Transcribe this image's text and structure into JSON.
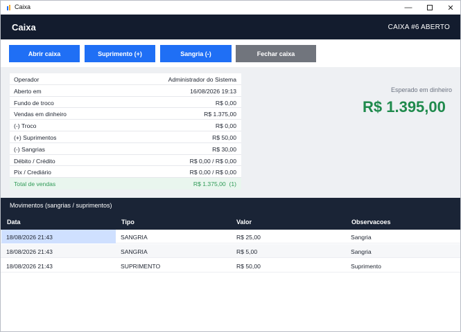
{
  "window": {
    "title": "Caixa"
  },
  "header": {
    "title": "Caixa",
    "status": "CAIXA #6 ABERTO"
  },
  "toolbar": {
    "buttons": [
      {
        "label": "Abrir caixa"
      },
      {
        "label": "Suprimento (+)"
      },
      {
        "label": "Sangria (-)"
      },
      {
        "label": "Fechar caixa"
      }
    ]
  },
  "summary": {
    "rows": [
      {
        "label": "Operador",
        "value": "Administrador do Sistema"
      },
      {
        "label": "Aberto em",
        "value": "16/08/2026 19:13"
      },
      {
        "label": "Fundo de troco",
        "value": "R$ 0,00"
      },
      {
        "label": "Vendas em dinheiro",
        "value": "R$ 1.375,00"
      },
      {
        "label": "(-) Troco",
        "value": "R$ 0,00"
      },
      {
        "label": "(+) Suprimentos",
        "value": "R$ 50,00"
      },
      {
        "label": "(-) Sangrias",
        "value": "R$ 30,00"
      },
      {
        "label": "Débito / Crédito",
        "value": "R$ 0,00 / R$ 0,00"
      },
      {
        "label": "Pix / Crediário",
        "value": "R$ 0,00 / R$ 0,00"
      }
    ],
    "total": {
      "label": "Total de vendas",
      "value": "R$ 1.375,00  (1)"
    }
  },
  "expected": {
    "label": "Esperado em dinheiro",
    "value": "R$ 1.395,00"
  },
  "movements": {
    "title": "Movimentos (sangrias / suprimentos)",
    "columns": [
      "Data",
      "Tipo",
      "Valor",
      "Observacoes"
    ],
    "rows": [
      {
        "data": "18/08/2026 21:43",
        "tipo": "SANGRIA",
        "valor": "R$ 25,00",
        "obs": "Sangria"
      },
      {
        "data": "18/08/2026 21:43",
        "tipo": "SANGRIA",
        "valor": "R$ 5,00",
        "obs": "Sangria"
      },
      {
        "data": "18/08/2026 21:43",
        "tipo": "SUPRIMENTO",
        "valor": "R$ 50,00",
        "obs": "Suprimento"
      }
    ]
  },
  "colors": {
    "header_bg": "#131c2e",
    "primary": "#1f6ff5",
    "secondary": "#71757d",
    "success": "#1f8a4c"
  },
  "icons": [
    "app-icon",
    "minimize-icon",
    "maximize-icon",
    "close-icon"
  ]
}
